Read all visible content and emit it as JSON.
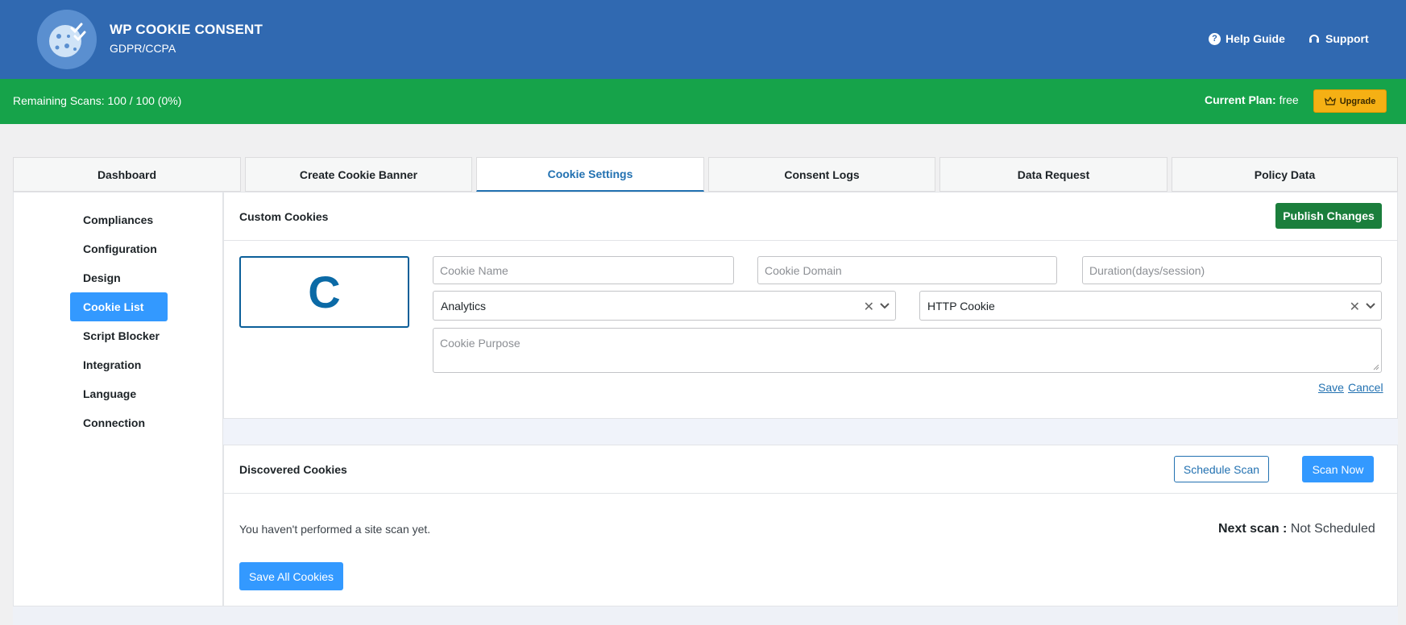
{
  "header": {
    "title": "WP COOKIE CONSENT",
    "subtitle": "GDPR/CCPA",
    "help_label": "Help Guide",
    "support_label": "Support"
  },
  "planbar": {
    "scans": "Remaining Scans: 100 / 100 (0%)",
    "plan_label": "Current Plan:",
    "plan_value": "free",
    "upgrade_label": "Upgrade"
  },
  "tabs": [
    {
      "label": "Dashboard"
    },
    {
      "label": "Create Cookie Banner"
    },
    {
      "label": "Cookie Settings",
      "active": true
    },
    {
      "label": "Consent Logs"
    },
    {
      "label": "Data Request"
    },
    {
      "label": "Policy Data"
    }
  ],
  "sidebar": {
    "items": [
      {
        "label": "Compliances"
      },
      {
        "label": "Configuration"
      },
      {
        "label": "Design"
      },
      {
        "label": "Cookie List",
        "active": true
      },
      {
        "label": "Script Blocker"
      },
      {
        "label": "Integration"
      },
      {
        "label": "Language"
      },
      {
        "label": "Connection"
      }
    ]
  },
  "custom_cookies": {
    "title": "Custom Cookies",
    "publish_label": "Publish Changes",
    "letter": "C",
    "name_placeholder": "Cookie Name",
    "domain_placeholder": "Cookie Domain",
    "duration_placeholder": "Duration(days/session)",
    "category_value": "Analytics",
    "type_value": "HTTP Cookie",
    "purpose_placeholder": "Cookie Purpose",
    "save_label": "Save",
    "cancel_label": "Cancel"
  },
  "discovered": {
    "title": "Discovered Cookies",
    "schedule_label": "Schedule Scan",
    "scan_now_label": "Scan Now",
    "no_scan_text": "You haven't performed a site scan yet.",
    "next_scan_label": "Next scan :",
    "next_scan_value": "Not Scheduled",
    "save_all_label": "Save All Cookies"
  },
  "colors": {
    "header": "#3069b1",
    "planbar": "#16a34a",
    "accent": "#3399ff",
    "publish": "#1b7e3c",
    "upgrade": "#f5b014"
  }
}
